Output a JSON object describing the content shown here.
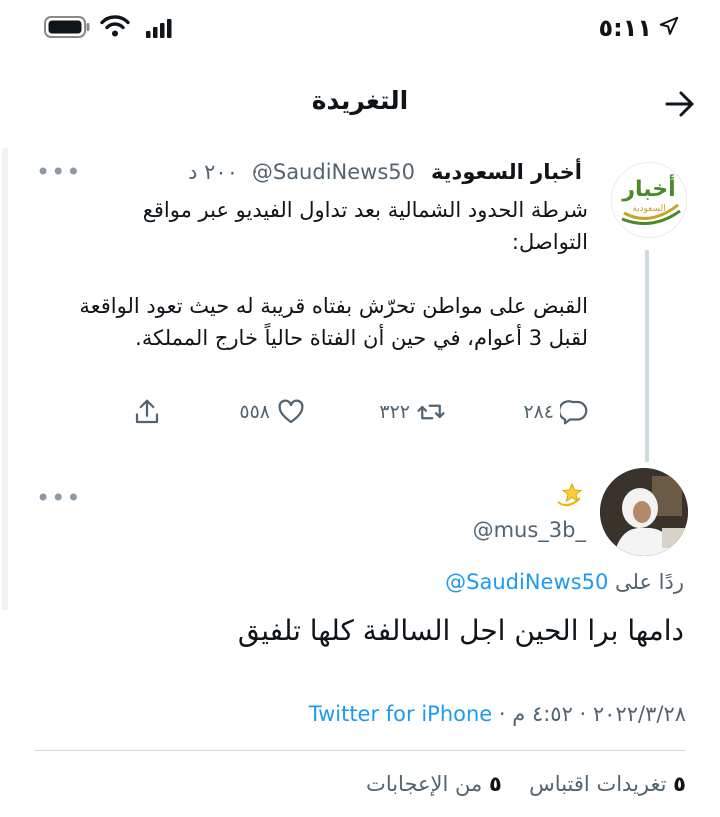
{
  "status_bar": {
    "time": "٥:١١"
  },
  "header": {
    "title": "التغريدة"
  },
  "quoted_tweet": {
    "author_name": "أخبار السعودية",
    "author_handle": "@SaudiNews50",
    "time": "٢٠٠ د",
    "dot": "·",
    "text": "شرطة الحدود الشمالية بعد تداول الفيديو عبر مواقع التواصل:\n\nالقبض على مواطن تحرّش بفتاه قريبة له حيث تعود الواقعة لقبل 3 أعوام، في حين أن الفتاة حالياً خارج المملكة.",
    "avatar_text_top": "أخبار",
    "avatar_text_bottom": "السعودية",
    "replies": "٢٨٤",
    "retweets": "٣٢٢",
    "likes": "٥٥٨"
  },
  "reply_tweet": {
    "author_handle": "@mus_3b_",
    "replying_prefix": "ردًا على",
    "replying_to": "@SaudiNews50",
    "text": "دامها برا الحين اجل السالفة كلها تلفيق",
    "date_time": "٢٠٢٢/٣/٢٨ · ٤:٥٢ م ·",
    "source": "Twitter for iPhone"
  },
  "stats": {
    "retweets_count": "٥",
    "retweets_label": "تغريدات",
    "quotes_label": "اقتباس",
    "likes_count": "٥",
    "likes_label": "من الإعجابات"
  },
  "icons": {
    "back": "arrow-right-icon",
    "reply": "speech-bubble-icon",
    "retweet": "retweet-icon",
    "like": "heart-icon",
    "share": "share-icon",
    "emoji": "dizzy-star-icon"
  },
  "colors": {
    "link": "#1d9bf0",
    "secondary_text": "#536471",
    "avatar_green": "#4a8a2a",
    "avatar_gold": "#c9a227"
  }
}
